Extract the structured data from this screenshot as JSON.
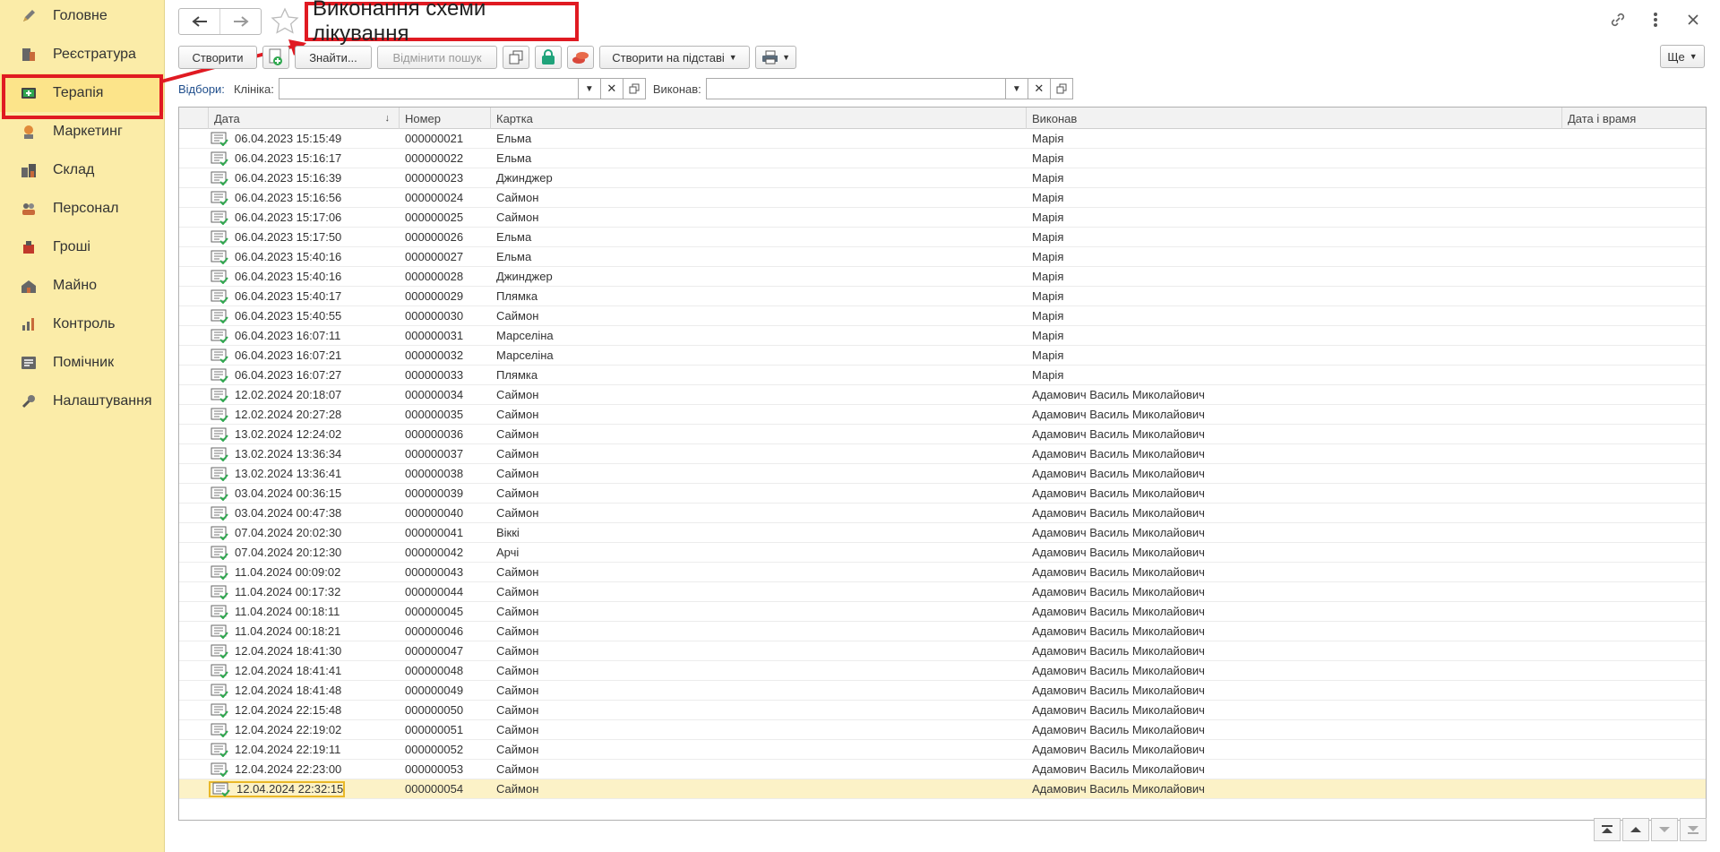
{
  "sidebar": {
    "items": [
      {
        "label": "Головне",
        "icon": "pencil-icon"
      },
      {
        "label": "Реєстратура",
        "icon": "register-icon"
      },
      {
        "label": "Терапія",
        "icon": "therapy-icon"
      },
      {
        "label": "Маркетинг",
        "icon": "marketing-icon"
      },
      {
        "label": "Склад",
        "icon": "warehouse-icon"
      },
      {
        "label": "Персонал",
        "icon": "staff-icon"
      },
      {
        "label": "Гроші",
        "icon": "money-icon"
      },
      {
        "label": "Майно",
        "icon": "property-icon"
      },
      {
        "label": "Контроль",
        "icon": "chart-icon"
      },
      {
        "label": "Помічник",
        "icon": "assistant-icon"
      },
      {
        "label": "Налаштування",
        "icon": "wrench-icon"
      }
    ],
    "active": "Терапія"
  },
  "header": {
    "title": "Виконання схеми лікування"
  },
  "toolbar": {
    "create_label": "Створити",
    "find_label": "Знайти...",
    "cancel_search_label": "Відмінити пошук",
    "create_based_label": "Створити на підставі",
    "more_label": "Ще"
  },
  "filters": {
    "label": "Відбори:",
    "clinic_label": "Клініка:",
    "clinic_value": "",
    "executed_label": "Виконав:",
    "executed_value": ""
  },
  "table": {
    "columns": [
      "Дата",
      "Номер",
      "Картка",
      "Виконав",
      "Дата і врамя"
    ],
    "rows": [
      [
        "06.04.2023 15:15:49",
        "000000021",
        "Ельма",
        "Марія"
      ],
      [
        "06.04.2023 15:16:17",
        "000000022",
        "Ельма",
        "Марія"
      ],
      [
        "06.04.2023 15:16:39",
        "000000023",
        "Джинджер",
        "Марія"
      ],
      [
        "06.04.2023 15:16:56",
        "000000024",
        "Саймон",
        "Марія"
      ],
      [
        "06.04.2023 15:17:06",
        "000000025",
        "Саймон",
        "Марія"
      ],
      [
        "06.04.2023 15:17:50",
        "000000026",
        "Ельма",
        "Марія"
      ],
      [
        "06.04.2023 15:40:16",
        "000000027",
        "Ельма",
        "Марія"
      ],
      [
        "06.04.2023 15:40:16",
        "000000028",
        "Джинджер",
        "Марія"
      ],
      [
        "06.04.2023 15:40:17",
        "000000029",
        "Плямка",
        "Марія"
      ],
      [
        "06.04.2023 15:40:55",
        "000000030",
        "Саймон",
        "Марія"
      ],
      [
        "06.04.2023 16:07:11",
        "000000031",
        "Марселіна",
        "Марія"
      ],
      [
        "06.04.2023 16:07:21",
        "000000032",
        "Марселіна",
        "Марія"
      ],
      [
        "06.04.2023 16:07:27",
        "000000033",
        "Плямка",
        "Марія"
      ],
      [
        "12.02.2024 20:18:07",
        "000000034",
        "Саймон",
        "Адамович Василь Миколайович"
      ],
      [
        "12.02.2024 20:27:28",
        "000000035",
        "Саймон",
        "Адамович Василь Миколайович"
      ],
      [
        "13.02.2024 12:24:02",
        "000000036",
        "Саймон",
        "Адамович Василь Миколайович"
      ],
      [
        "13.02.2024 13:36:34",
        "000000037",
        "Саймон",
        "Адамович Василь Миколайович"
      ],
      [
        "13.02.2024 13:36:41",
        "000000038",
        "Саймон",
        "Адамович Василь Миколайович"
      ],
      [
        "03.04.2024 00:36:15",
        "000000039",
        "Саймон",
        "Адамович Василь Миколайович"
      ],
      [
        "03.04.2024 00:47:38",
        "000000040",
        "Саймон",
        "Адамович Василь Миколайович"
      ],
      [
        "07.04.2024 20:02:30",
        "000000041",
        "Віккі",
        "Адамович Василь Миколайович"
      ],
      [
        "07.04.2024 20:12:30",
        "000000042",
        "Арчі",
        "Адамович Василь Миколайович"
      ],
      [
        "11.04.2024 00:09:02",
        "000000043",
        "Саймон",
        "Адамович Василь Миколайович"
      ],
      [
        "11.04.2024 00:17:32",
        "000000044",
        "Саймон",
        "Адамович Василь Миколайович"
      ],
      [
        "11.04.2024 00:18:11",
        "000000045",
        "Саймон",
        "Адамович Василь Миколайович"
      ],
      [
        "11.04.2024 00:18:21",
        "000000046",
        "Саймон",
        "Адамович Василь Миколайович"
      ],
      [
        "12.04.2024 18:41:30",
        "000000047",
        "Саймон",
        "Адамович Василь Миколайович"
      ],
      [
        "12.04.2024 18:41:41",
        "000000048",
        "Саймон",
        "Адамович Василь Миколайович"
      ],
      [
        "12.04.2024 18:41:48",
        "000000049",
        "Саймон",
        "Адамович Василь Миколайович"
      ],
      [
        "12.04.2024 22:15:48",
        "000000050",
        "Саймон",
        "Адамович Василь Миколайович"
      ],
      [
        "12.04.2024 22:19:02",
        "000000051",
        "Саймон",
        "Адамович Василь Миколайович"
      ],
      [
        "12.04.2024 22:19:11",
        "000000052",
        "Саймон",
        "Адамович Василь Миколайович"
      ],
      [
        "12.04.2024 22:23:00",
        "000000053",
        "Саймон",
        "Адамович Василь Миколайович"
      ],
      [
        "12.04.2024 22:32:15",
        "000000054",
        "Саймон",
        "Адамович Василь Миколайович"
      ]
    ],
    "selected_index": 33
  },
  "colors": {
    "sidebar_bg": "#fbeca8",
    "highlight_red": "#e01a22",
    "selected_row": "#fcf2c7",
    "accent_green": "#1fa37a"
  }
}
